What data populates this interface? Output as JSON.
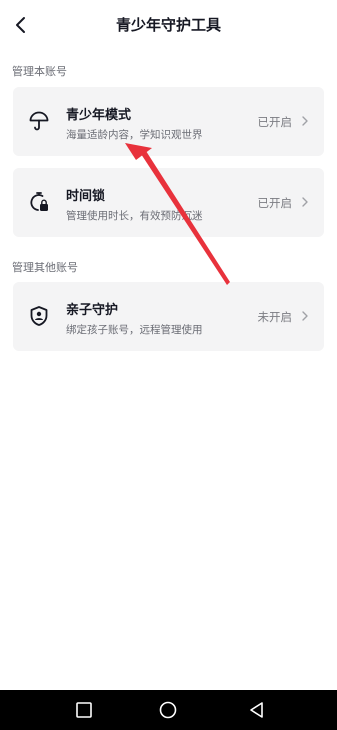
{
  "header": {
    "title": "青少年守护工具",
    "back_icon": "chevron-left-icon"
  },
  "sections": {
    "own_account": {
      "label": "管理本账号"
    },
    "other_accounts": {
      "label": "管理其他账号"
    }
  },
  "cards": {
    "teen_mode": {
      "title": "青少年模式",
      "desc": "海量适龄内容，学知识观世界",
      "status": "已开启",
      "icon": "umbrella-icon"
    },
    "time_lock": {
      "title": "时间锁",
      "desc": "管理使用时长，有效预防沉迷",
      "status": "已开启",
      "icon": "timer-lock-icon"
    },
    "parental": {
      "title": "亲子守护",
      "desc": "绑定孩子账号，远程管理使用",
      "status": "未开启",
      "icon": "shield-user-icon"
    }
  },
  "navbar": {
    "icons": [
      "square-recent-icon",
      "circle-home-icon",
      "triangle-back-icon"
    ]
  },
  "colors": {
    "annotation_arrow": "#e8323c",
    "card_bg": "#f4f4f5",
    "navbar_bg": "#000000"
  }
}
